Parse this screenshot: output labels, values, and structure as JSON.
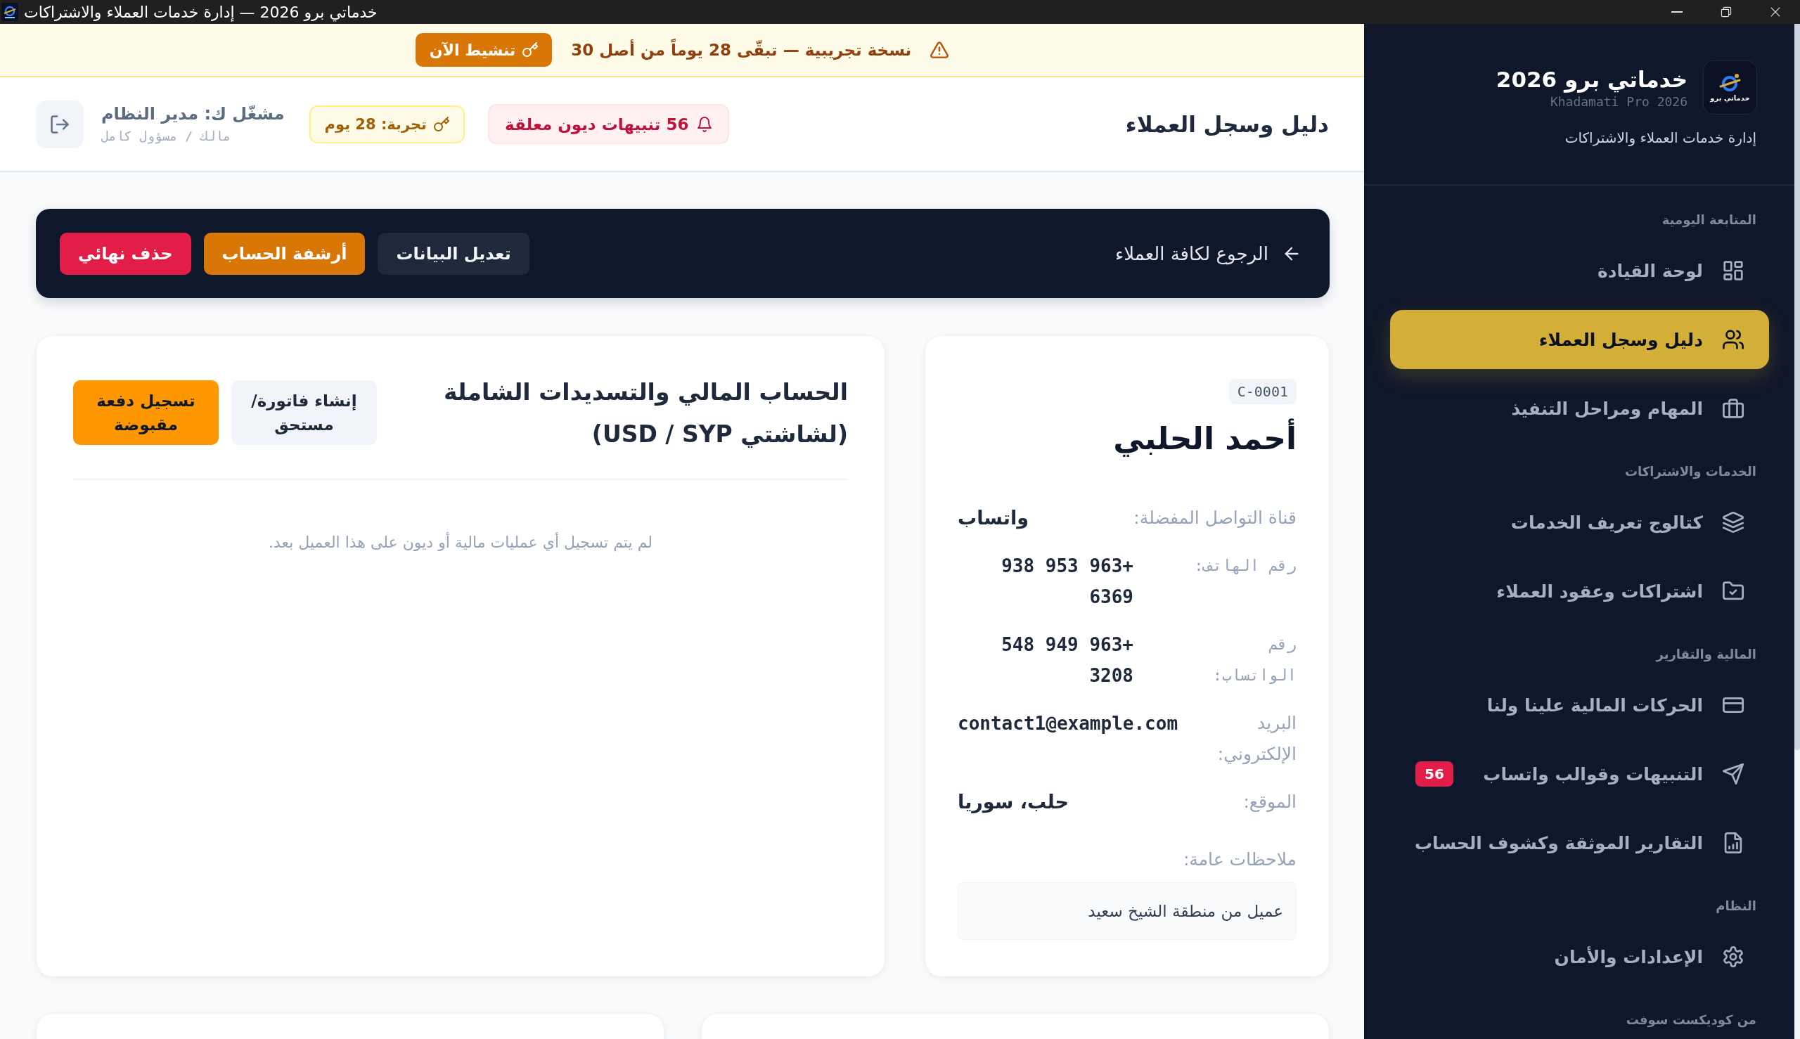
{
  "window": {
    "title": "خدماتي برو 2026 — إدارة خدمات العملاء والاشتراكات"
  },
  "sidebar": {
    "logo_text": "خدماتي برو",
    "app_name": "خدماتي برو 2026",
    "app_name_latin": "Khadamati Pro 2026",
    "tagline": "إدارة خدمات العملاء والاشتراكات",
    "sections": [
      {
        "title": "المتابعة اليومية",
        "items": [
          {
            "label": "لوحة القيادة",
            "selected": false
          },
          {
            "label": "دليل وسجل العملاء",
            "selected": true
          },
          {
            "label": "المهام ومراحل التنفيذ",
            "selected": false
          }
        ]
      },
      {
        "title": "الخدمات والاشتراكات",
        "items": [
          {
            "label": "كتالوج تعريف الخدمات",
            "selected": false
          },
          {
            "label": "اشتراكات وعقود العملاء",
            "selected": false
          }
        ]
      },
      {
        "title": "المالية والتقارير",
        "items": [
          {
            "label": "الحركات المالية علينا ولنا",
            "selected": false
          },
          {
            "label": "التنبيهات وقوالب واتساب",
            "selected": false,
            "badge": "56"
          },
          {
            "label": "التقارير الموثقة وكشوف الحساب",
            "selected": false
          }
        ]
      },
      {
        "title": "النظام",
        "items": [
          {
            "label": "الإعدادات والأمان",
            "selected": false
          }
        ]
      },
      {
        "title": "من كوديكست سوفت"
      }
    ]
  },
  "trial_banner": {
    "message": "نسخة تجريبية — تبقّى 28 يوماً من أصل 30",
    "button": "تنشيط الآن"
  },
  "header": {
    "title": "دليل وسجل العملاء",
    "alerts": "56 تنبيهات ديون معلقة",
    "trial": "تجربة: 28 يوم",
    "user": {
      "name": "مشغّل ك: مدير النظام",
      "role": "مالك / مسؤول كامل"
    }
  },
  "action_bar": {
    "back_link": "الرجوع لكافة العملاء",
    "buttons": [
      {
        "label": "تعديل البيانات",
        "kind": "neutral"
      },
      {
        "label": "أرشفة الحساب",
        "kind": "warning"
      },
      {
        "label": "حذف نهائي",
        "kind": "danger"
      }
    ]
  },
  "client_card": {
    "code": "C-0001",
    "name": "أحمد الحلبي",
    "fields": [
      {
        "kind": "text",
        "label": "قناة التواصل المفضلة:",
        "value": "واتساب"
      },
      {
        "kind": "phone",
        "label": "رقم الهاتف:",
        "value": "+963 953 938 6369"
      },
      {
        "kind": "phone",
        "label": "رقم الواتساب:",
        "value": "+963 949 548 3208"
      },
      {
        "kind": "email",
        "label": "البريد الإلكتروني:",
        "value": "contact1@example.com"
      },
      {
        "kind": "text",
        "label": "الموقع:",
        "value": "حلب، سوريا"
      }
    ],
    "notes_label": "ملاحظات عامة:",
    "notes": "عميل من منطقة الشيخ سعيد"
  },
  "finance_card": {
    "title": "الحساب المالي والتسديدات الشاملة (لشاشتي USD / SYP)",
    "buttons": [
      {
        "label": "إنشاء فاتورة/ مستحق",
        "kind": "secondary"
      },
      {
        "label": "تسجيل دفعة مقبوضة",
        "kind": "primary"
      }
    ],
    "empty_message": "لم يتم تسجيل أي عمليات مالية أو ديون على هذا العميل بعد."
  }
}
